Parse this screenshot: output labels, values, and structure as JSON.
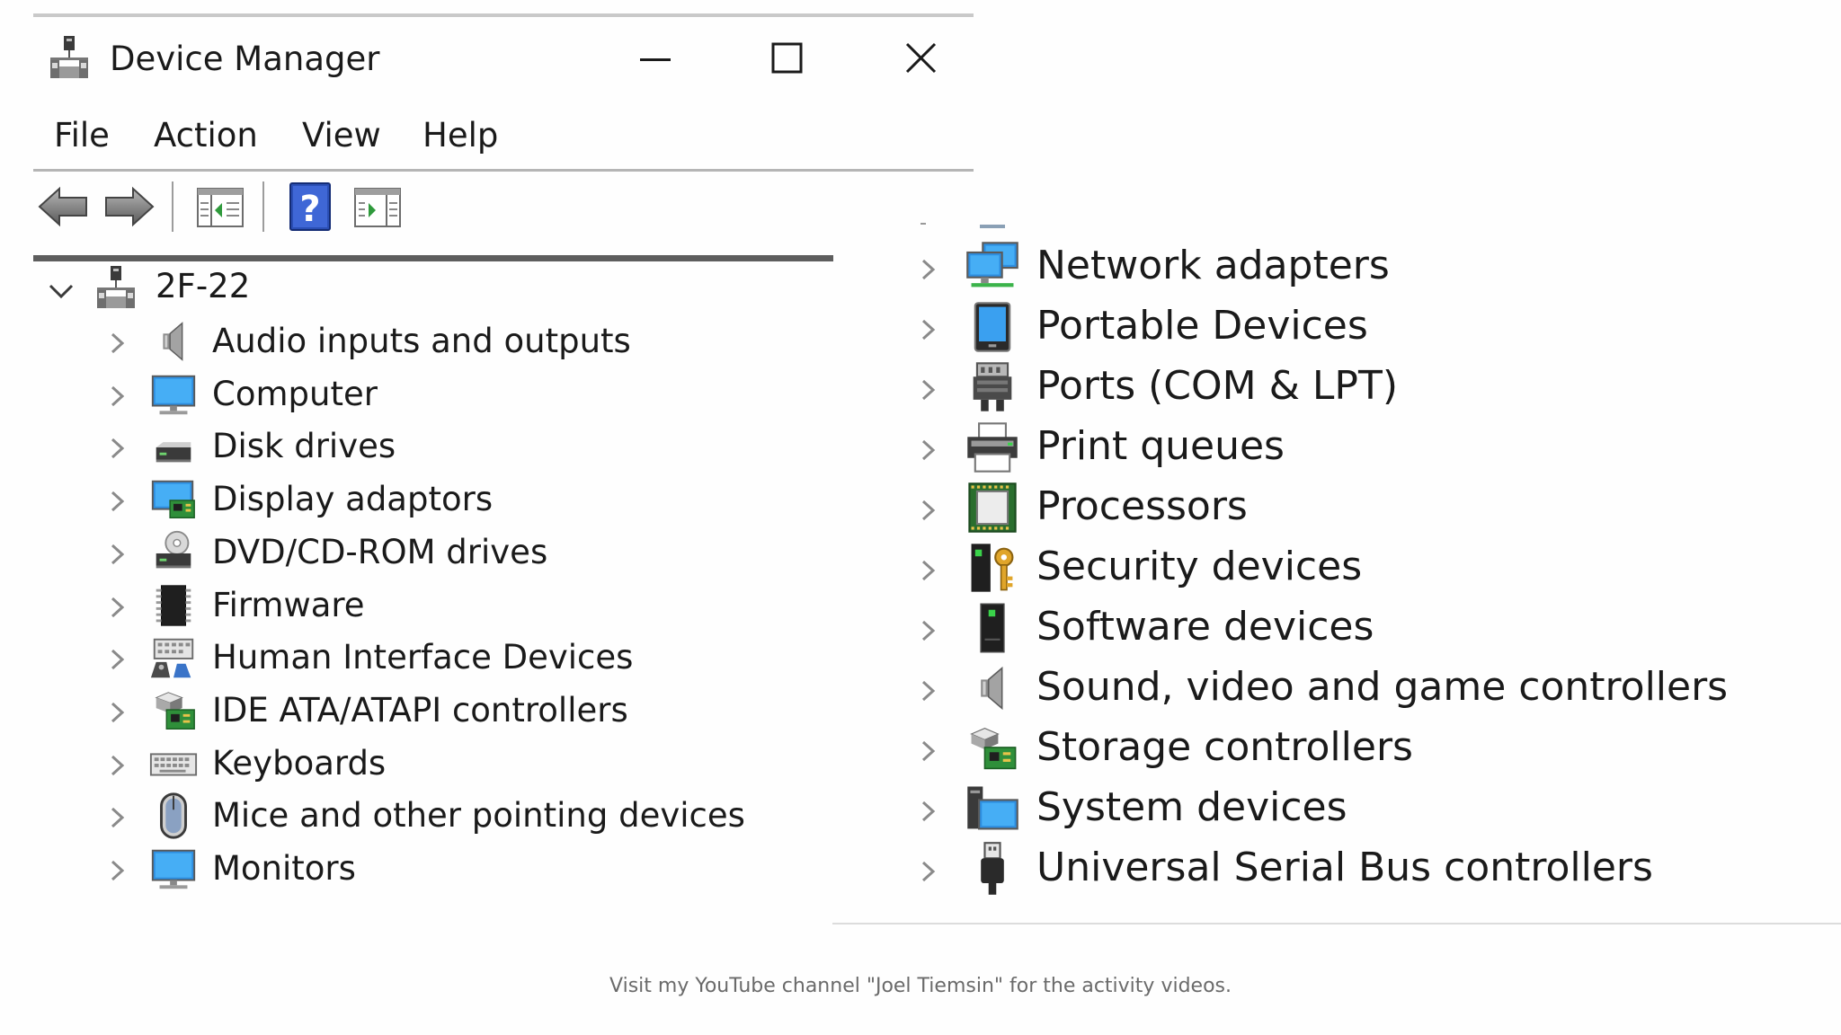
{
  "window": {
    "title": "Device Manager",
    "controls": {
      "minimize": "minimize-icon",
      "maximize": "maximize-icon",
      "close": "close-icon"
    }
  },
  "menu": [
    "File",
    "Action",
    "View",
    "Help"
  ],
  "toolbar": [
    "back-arrow-icon",
    "forward-arrow-icon",
    "show-hide-console-tree-icon",
    "help-icon",
    "show-hide-action-pane-icon"
  ],
  "tree": {
    "root": "2F-22",
    "left_items": [
      {
        "label": "Audio inputs and outputs",
        "icon": "speaker-icon"
      },
      {
        "label": "Computer",
        "icon": "computer-monitor-icon"
      },
      {
        "label": "Disk drives",
        "icon": "disk-drive-icon"
      },
      {
        "label": "Display adaptors",
        "icon": "display-adapter-icon"
      },
      {
        "label": "DVD/CD-ROM drives",
        "icon": "dvd-drive-icon"
      },
      {
        "label": "Firmware",
        "icon": "chip-icon"
      },
      {
        "label": "Human Interface Devices",
        "icon": "hid-icon"
      },
      {
        "label": "IDE ATA/ATAPI controllers",
        "icon": "ide-controller-icon"
      },
      {
        "label": "Keyboards",
        "icon": "keyboard-icon"
      },
      {
        "label": "Mice and other pointing devices",
        "icon": "mouse-icon"
      },
      {
        "label": "Monitors",
        "icon": "monitor-icon"
      }
    ],
    "right_items": [
      {
        "label": "Network adapters",
        "icon": "network-adapter-icon"
      },
      {
        "label": "Portable Devices",
        "icon": "portable-device-icon"
      },
      {
        "label": "Ports (COM & LPT)",
        "icon": "port-icon"
      },
      {
        "label": "Print queues",
        "icon": "printer-icon"
      },
      {
        "label": "Processors",
        "icon": "processor-icon"
      },
      {
        "label": "Security devices",
        "icon": "security-key-icon"
      },
      {
        "label": "Software devices",
        "icon": "software-device-icon"
      },
      {
        "label": "Sound, video and game controllers",
        "icon": "sound-controller-icon"
      },
      {
        "label": "Storage controllers",
        "icon": "storage-controller-icon"
      },
      {
        "label": "System devices",
        "icon": "system-devices-icon"
      },
      {
        "label": "Universal Serial Bus controllers",
        "icon": "usb-plug-icon"
      }
    ]
  },
  "footer": "Visit my YouTube channel \"Joel Tiemsin\" for the activity videos."
}
